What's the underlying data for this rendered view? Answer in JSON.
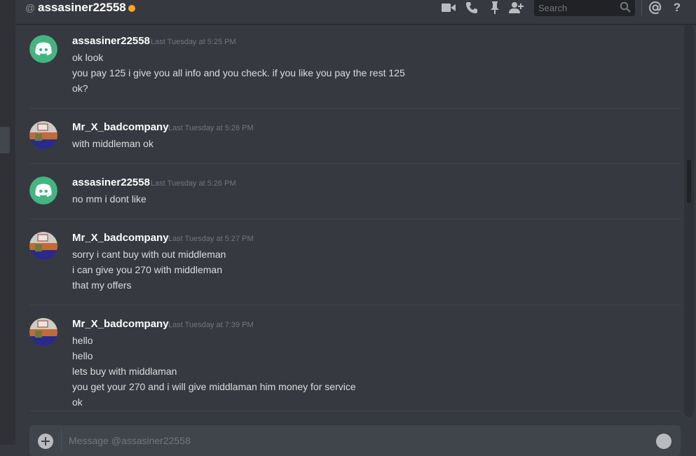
{
  "header": {
    "at_symbol": "@",
    "title": "assasiner22558",
    "status_color": "#faa61a",
    "icons": [
      "video-icon",
      "phone-icon",
      "pin-icon",
      "add-member-icon",
      "mention-icon",
      "help-icon"
    ],
    "search_placeholder": "Search"
  },
  "messages": [
    {
      "author": "assasiner22558",
      "avatar": "discord-logo-avatar",
      "timestamp": "Last Tuesday at 5:25 PM",
      "lines": [
        "ok look",
        "you pay 125 i give you all info and you check. if you like you pay the rest 125",
        "ok?"
      ]
    },
    {
      "author": "Mr_X_badcompany",
      "avatar": "user-photo-avatar",
      "timestamp": "Last Tuesday at 5:26 PM",
      "lines": [
        "with middleman ok"
      ]
    },
    {
      "author": "assasiner22558",
      "avatar": "discord-logo-avatar",
      "timestamp": "Last Tuesday at 5:26 PM",
      "lines": [
        "no mm i dont like"
      ]
    },
    {
      "author": "Mr_X_badcompany",
      "avatar": "user-photo-avatar",
      "timestamp": "Last Tuesday at 5:27 PM",
      "lines": [
        "sorry i cant buy with out middleman",
        "i can give you 270 with middleman",
        "that my offers"
      ]
    },
    {
      "author": "Mr_X_badcompany",
      "avatar": "user-photo-avatar",
      "timestamp": "Last Tuesday at 7:39 PM",
      "lines": [
        "hello",
        "hello",
        "lets buy with middlaman",
        "you get your 270 and i will give middlaman him money for service",
        "ok"
      ]
    }
  ],
  "composer": {
    "placeholder": "Message @assasiner22558"
  },
  "colors": {
    "background": "#36393f",
    "discord_green": "#43b581",
    "username": "#ffffff",
    "timestamp": "#72767d"
  }
}
